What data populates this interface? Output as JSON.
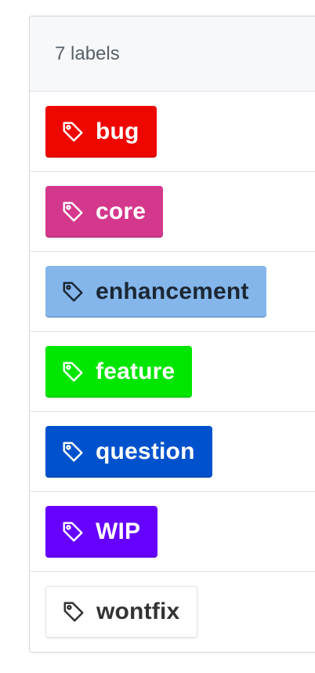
{
  "header": {
    "count_text": "7 labels"
  },
  "labels": [
    {
      "name": "bug",
      "bg": "#ee0701",
      "fg": "#ffffff"
    },
    {
      "name": "core",
      "bg": "#d4388c",
      "fg": "#ffffff"
    },
    {
      "name": "enhancement",
      "bg": "#84b6eb",
      "fg": "#1c2733"
    },
    {
      "name": "feature",
      "bg": "#00e600",
      "fg": "#ffffff"
    },
    {
      "name": "question",
      "bg": "#0052cc",
      "fg": "#ffffff"
    },
    {
      "name": "WIP",
      "bg": "#6600ff",
      "fg": "#ffffff"
    },
    {
      "name": "wontfix",
      "bg": "#ffffff",
      "fg": "#333333"
    }
  ],
  "icon": "tag-icon"
}
